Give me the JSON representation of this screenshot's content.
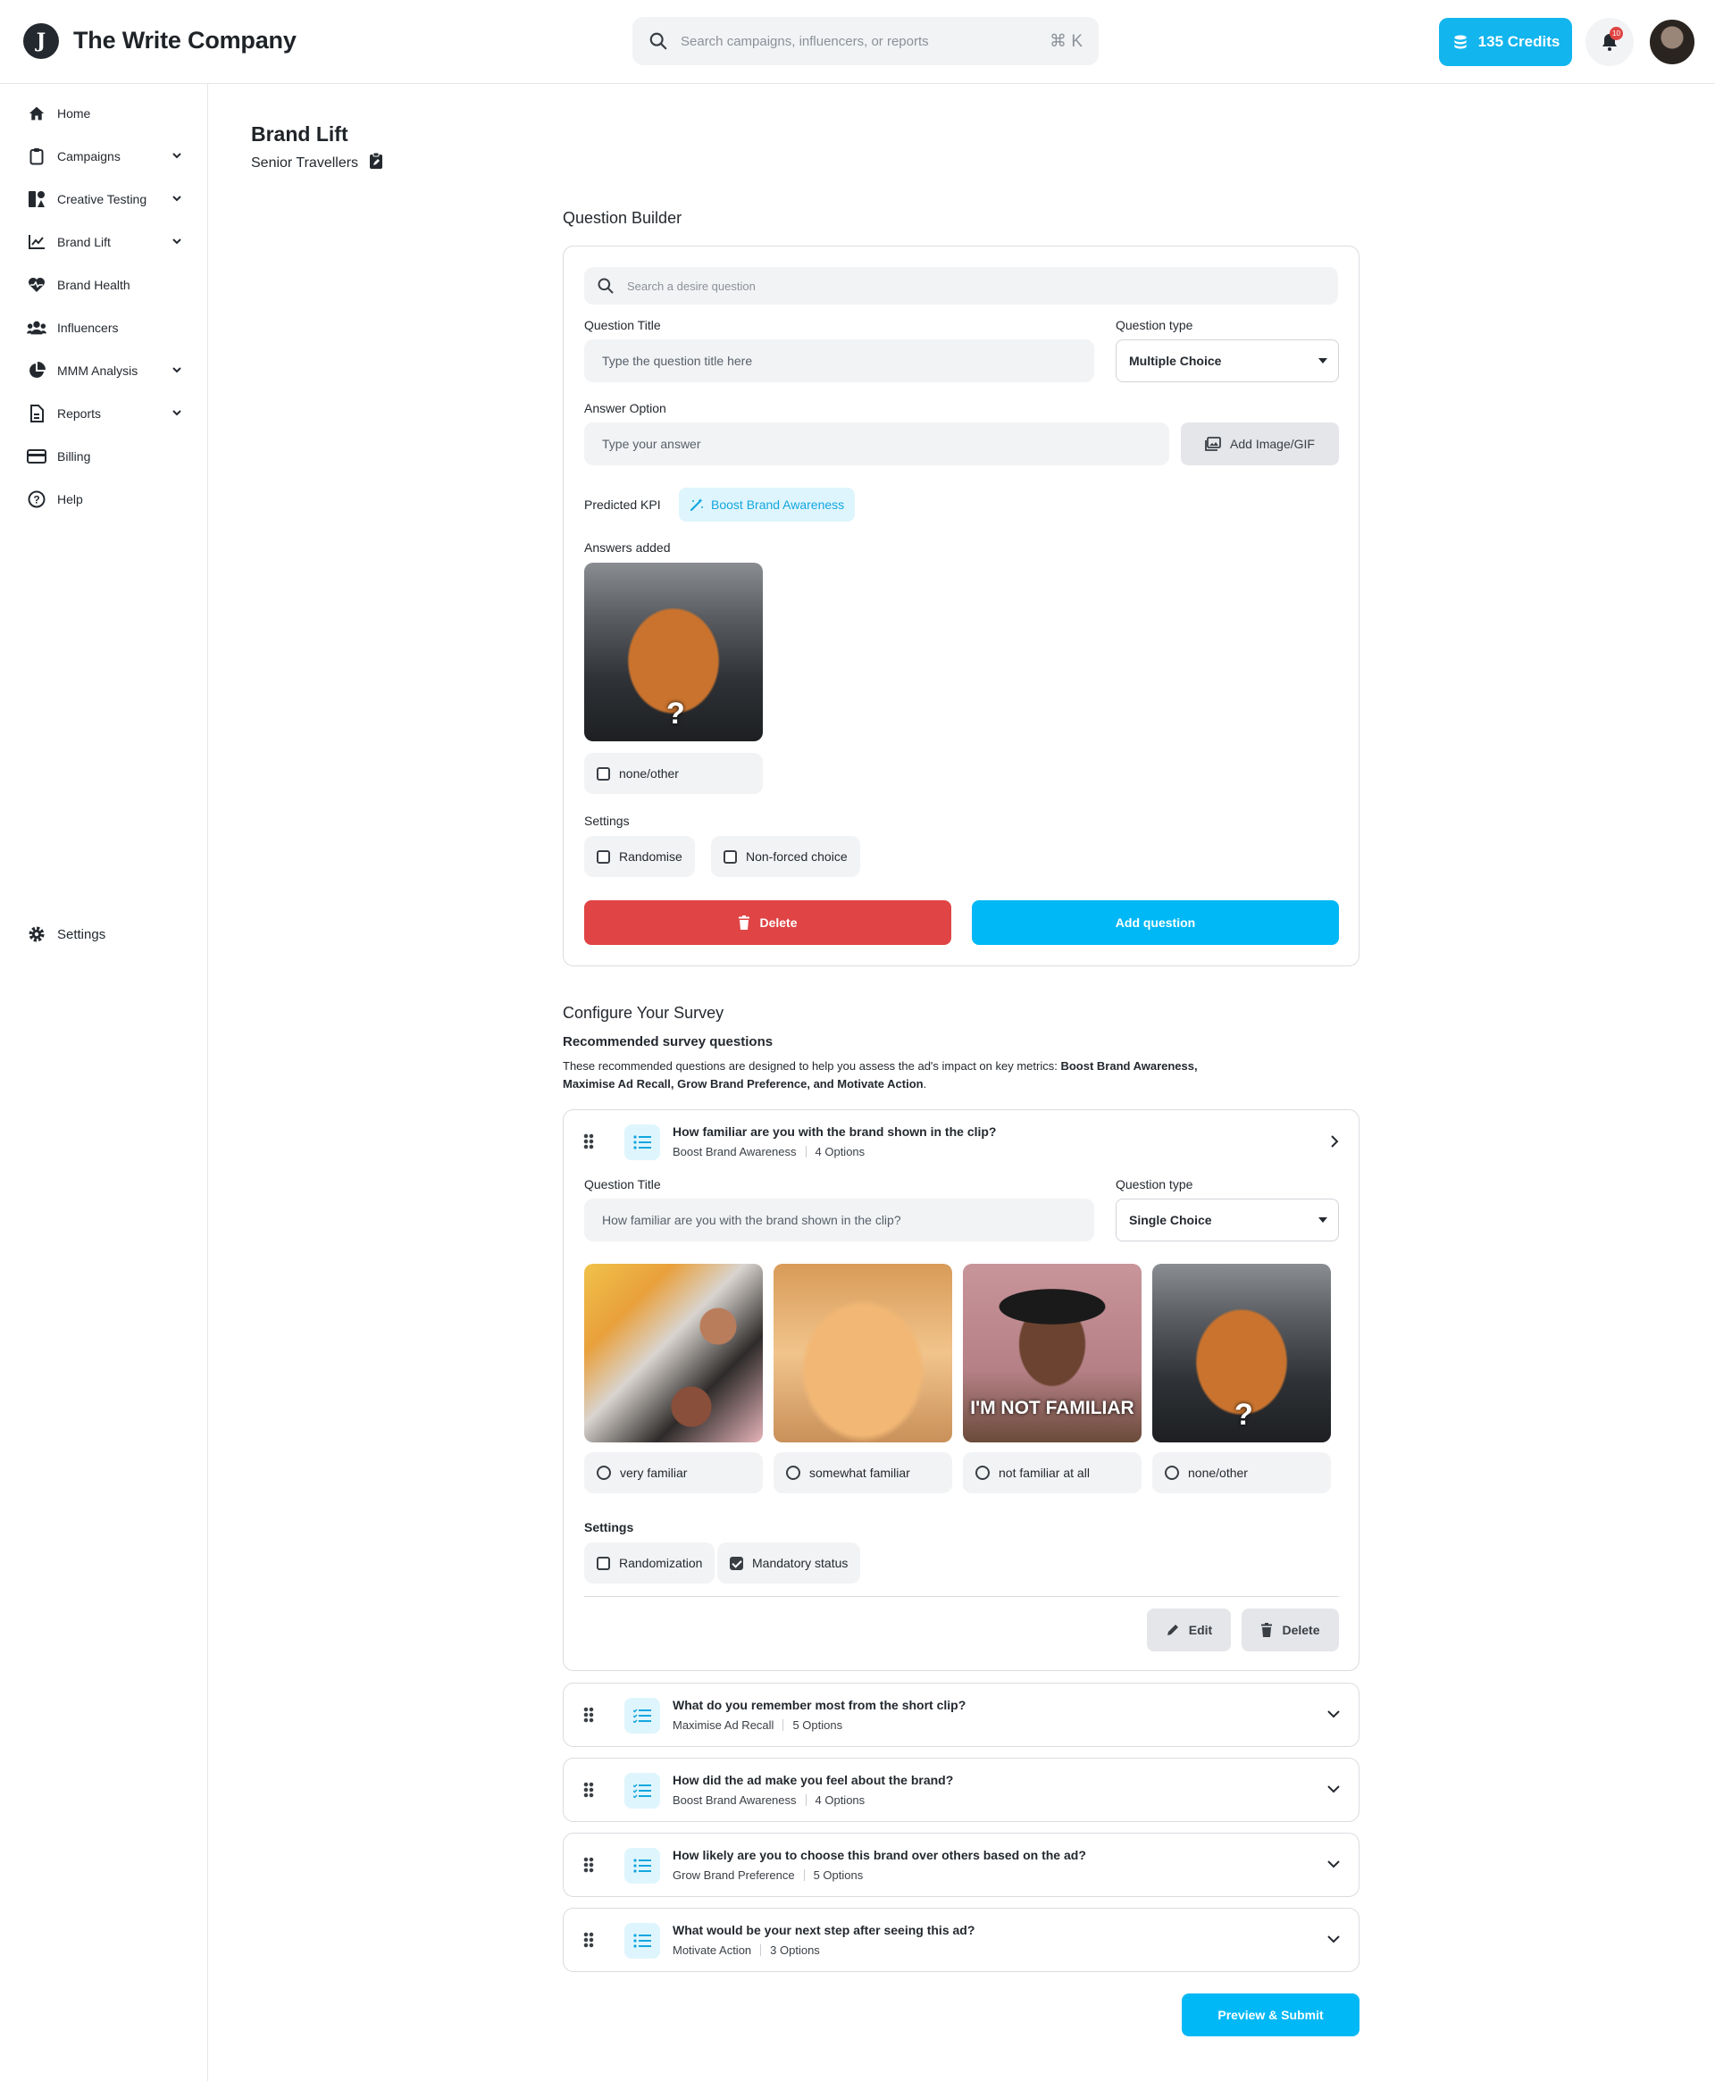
{
  "header": {
    "logo_letter": "J",
    "brand": "The Write Company",
    "search_placeholder": "Search campaigns, influencers, or reports",
    "search_shortcut": "⌘ K",
    "credits_label": "135 Credits",
    "notifications_count": "10"
  },
  "sidebar": {
    "items": [
      {
        "label": "Home",
        "icon": "home-icon",
        "expandable": false
      },
      {
        "label": "Campaigns",
        "icon": "clipboard-icon",
        "expandable": true
      },
      {
        "label": "Creative Testing",
        "icon": "shapes-icon",
        "expandable": true
      },
      {
        "label": "Brand Lift",
        "icon": "chart-line-icon",
        "expandable": true
      },
      {
        "label": "Brand Health",
        "icon": "heart-pulse-icon",
        "expandable": false
      },
      {
        "label": "Influencers",
        "icon": "users-icon",
        "expandable": false
      },
      {
        "label": "MMM Analysis",
        "icon": "pie-chart-icon",
        "expandable": true
      },
      {
        "label": "Reports",
        "icon": "report-icon",
        "expandable": true
      },
      {
        "label": "Billing",
        "icon": "credit-card-icon",
        "expandable": false
      },
      {
        "label": "Help",
        "icon": "help-icon",
        "expandable": false
      }
    ],
    "settings_label": "Settings"
  },
  "page": {
    "title": "Brand Lift",
    "subtitle": "Senior Travellers"
  },
  "builder": {
    "section_title": "Question Builder",
    "search_placeholder": "Search a desire question",
    "question_title_label": "Question Title",
    "question_title_placeholder": "Type the question title here",
    "question_type_label": "Question type",
    "question_type_value": "Multiple Choice",
    "answer_option_label": "Answer Option",
    "answer_placeholder": "Type your answer",
    "add_image_label": "Add Image/GIF",
    "predicted_kpi_label": "Predicted KPI",
    "predicted_kpi_value": "Boost Brand Awareness",
    "answers_added_label": "Answers added",
    "answer_added_text": "none/other",
    "settings_label": "Settings",
    "settings": [
      "Randomise",
      "Non-forced choice"
    ],
    "delete_label": "Delete",
    "add_question_label": "Add question"
  },
  "configure": {
    "section_title": "Configure Your Survey",
    "recommended_title": "Recommended survey questions",
    "description_prefix": "These recommended questions are designed to help you assess the ad's impact on key metrics: ",
    "description_bold_1": "Boost Brand Awareness,",
    "description_bold_2": "Maximise Ad Recall, Grow Brand Preference, and Motivate Action",
    "description_suffix": ".",
    "expanded": {
      "title": "How familiar are you with the brand shown in the clip?",
      "kpi": "Boost Brand Awareness",
      "options_count": "4 Options",
      "question_title_label": "Question Title",
      "question_title_value": "How familiar are you with the brand shown in the clip?",
      "question_type_label": "Question type",
      "question_type_value": "Single Choice",
      "answers": [
        "very familiar",
        "somewhat familiar",
        "not familiar at all",
        "none/other"
      ],
      "gif_caption": "I'M NOT FAMILIAR",
      "settings_label": "Settings",
      "settings": [
        {
          "label": "Randomization",
          "checked": false
        },
        {
          "label": "Mandatory status",
          "checked": true
        }
      ],
      "edit_label": "Edit",
      "delete_label": "Delete"
    },
    "questions": [
      {
        "title": "What do you remember most from the short clip?",
        "kpi": "Maximise Ad Recall",
        "options": "5 Options",
        "icon": "checklist-icon"
      },
      {
        "title": "How did the ad make you feel about the brand?",
        "kpi": "Boost Brand Awareness",
        "options": "4 Options",
        "icon": "checklist-icon"
      },
      {
        "title": "How likely are you to choose this brand over others based on the ad?",
        "kpi": "Grow Brand Preference",
        "options": "5 Options",
        "icon": "list-icon"
      },
      {
        "title": "What would be your next step after seeing this ad?",
        "kpi": "Motivate Action",
        "options": "3 Options",
        "icon": "list-icon"
      }
    ],
    "submit_label": "Preview & Submit"
  },
  "colors": {
    "accent": "#00b8f5",
    "danger": "#e04444",
    "kpi_bg": "#dff5fd"
  }
}
